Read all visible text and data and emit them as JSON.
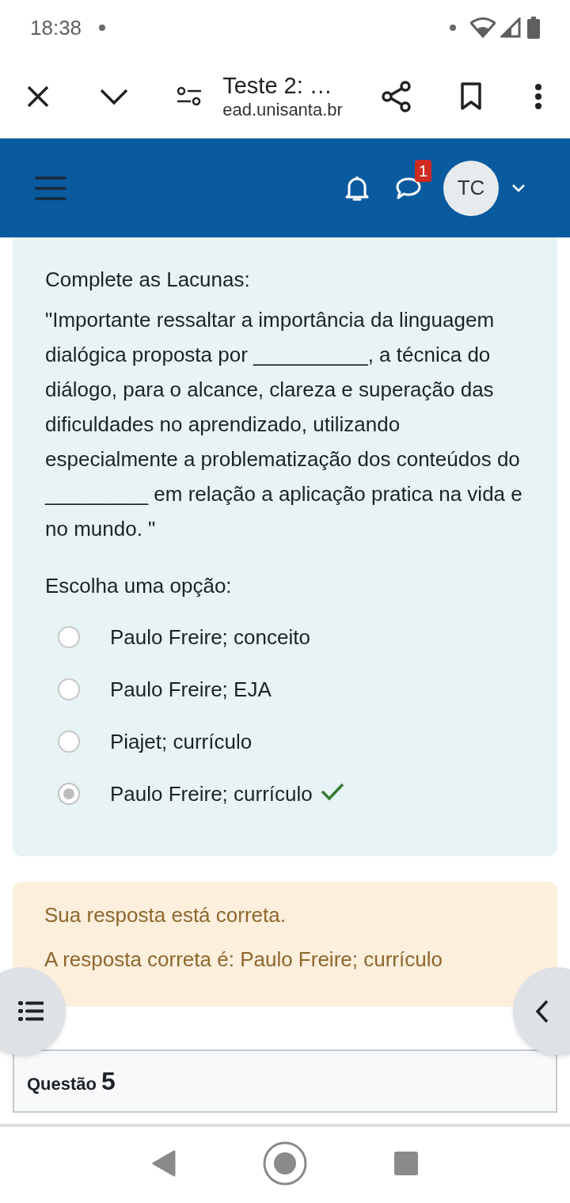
{
  "status_bar": {
    "time": "18:38"
  },
  "browser": {
    "title": "Teste 2: …",
    "url": "ead.unisanta.br"
  },
  "nav": {
    "message_badge": "1",
    "avatar": "TC"
  },
  "question": {
    "heading": "Complete as Lacunas:",
    "text": "\"Importante ressaltar a importância da linguagem dialógica proposta por __________, a técnica do diálogo, para o alcance, clareza e superação das dificuldades no aprendizado, utilizando especialmente a problematização dos conteúdos do _________ em relação a aplicação pratica na vida e no mundo. \"",
    "prompt": "Escolha uma opção:",
    "options": [
      {
        "label": "Paulo Freire; conceito",
        "selected": false,
        "correct": false
      },
      {
        "label": "Paulo Freire; EJA",
        "selected": false,
        "correct": false
      },
      {
        "label": "Piajet; currículo",
        "selected": false,
        "correct": false
      },
      {
        "label": "Paulo Freire; currículo",
        "selected": true,
        "correct": true
      }
    ]
  },
  "feedback": {
    "status": "Sua resposta está correta.",
    "answer": "A resposta correta é: Paulo Freire; currículo"
  },
  "next_question": {
    "label": "Questão",
    "number": "5"
  }
}
